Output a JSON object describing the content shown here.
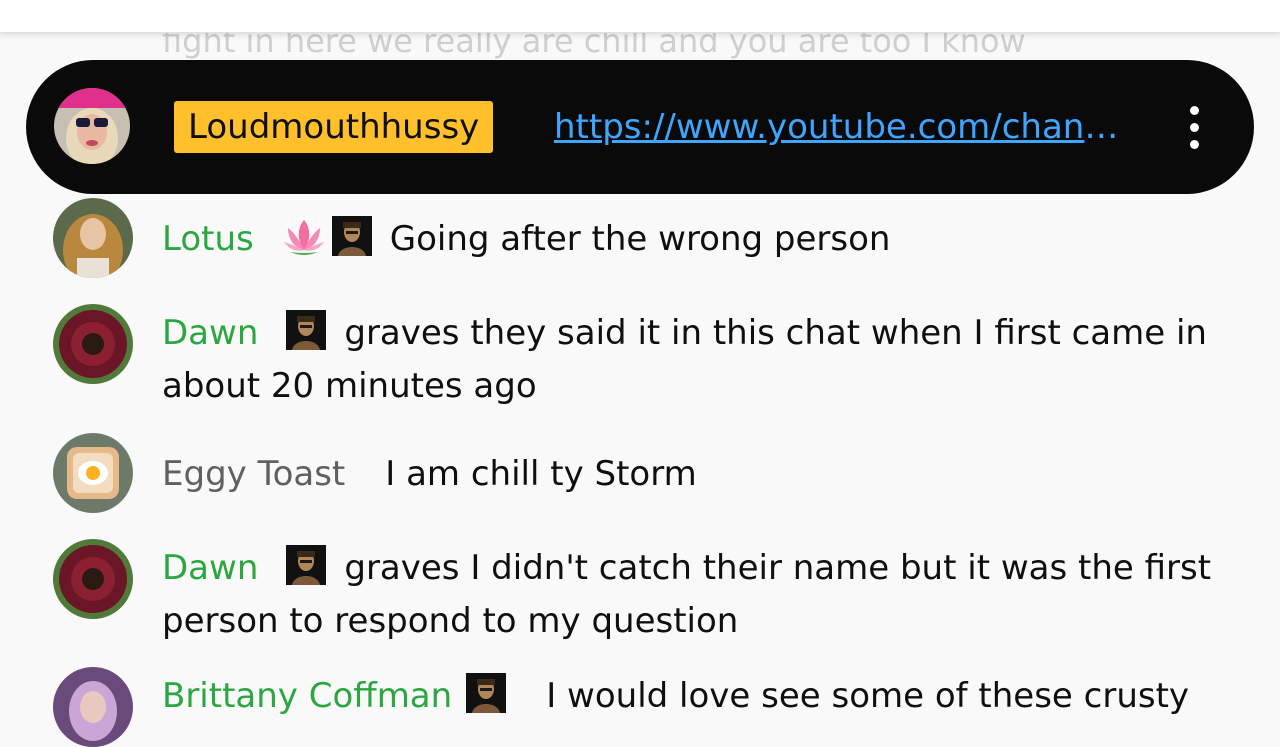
{
  "background_text": "fight in here we really are chill and you are too I know",
  "pinned": {
    "author": "Loudmouthhussy",
    "link": "https://www.youtube.com/channel/UC...",
    "menu_icon": "more-vert-icon",
    "colors": {
      "background": "#0a0a0a",
      "badge": "#ffc02b",
      "link": "#3ea6ff"
    }
  },
  "messages": [
    {
      "author": "Lotus",
      "author_emoji": "🪷",
      "member": true,
      "text": "Going after the wrong person"
    },
    {
      "author": "Dawn",
      "member": true,
      "text": "graves they said it in this chat when I first came in about 20 minutes ago"
    },
    {
      "author": "Eggy Toast",
      "member": false,
      "text": "I am chill ty Storm"
    },
    {
      "author": "Dawn",
      "member": true,
      "text": "graves I didn't catch their name but it was the first person to respond to my question"
    },
    {
      "author": "Brittany Coffman",
      "member": true,
      "text": "I would love see some of these crusty"
    }
  ],
  "colors": {
    "member_name": "#2ba640",
    "regular_name": "#606060",
    "text": "#0f0f0f",
    "page_bg": "#f9f9f9"
  }
}
